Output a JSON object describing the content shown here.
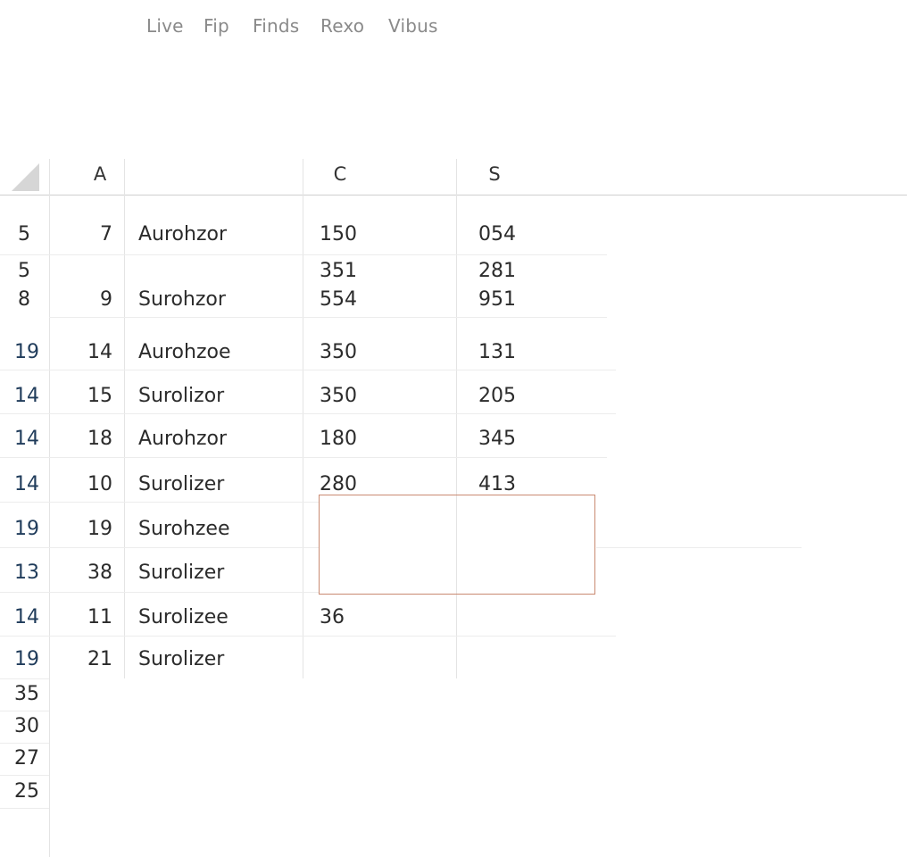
{
  "menu": {
    "items": [
      "Live",
      "Fip",
      "Finds",
      "Rexo",
      "Vibus"
    ]
  },
  "column_headers": [
    "A",
    "C",
    "S"
  ],
  "rows": [
    {
      "row": "5",
      "num": "7",
      "name": "Aurohzor",
      "c": "150",
      "s": "054"
    },
    {
      "row": "5",
      "num": "",
      "name": "",
      "c": "351",
      "s": "281"
    },
    {
      "row": "8",
      "num": "9",
      "name": "Surohzor",
      "c": "554",
      "s": "951"
    },
    {
      "row": "19",
      "num": "14",
      "name": "Aurohzoe",
      "c": "350",
      "s": "131"
    },
    {
      "row": "14",
      "num": "15",
      "name": "Surolizor",
      "c": "350",
      "s": "205"
    },
    {
      "row": "14",
      "num": "18",
      "name": "Aurohzor",
      "c": "180",
      "s": "345"
    },
    {
      "row": "14",
      "num": "10",
      "name": "Surolizer",
      "c": "280",
      "s": "413"
    },
    {
      "row": "19",
      "num": "19",
      "name": "Surohzee",
      "c": "",
      "s": ""
    },
    {
      "row": "13",
      "num": "38",
      "name": "Surolizer",
      "c": "",
      "s": ""
    },
    {
      "row": "14",
      "num": "11",
      "name": "Surolizee",
      "c": "36",
      "s": ""
    },
    {
      "row": "19",
      "num": "21",
      "name": "Surolizer",
      "c": "",
      "s": ""
    }
  ],
  "extra_row_numbers": [
    "35",
    "30",
    "27",
    "25"
  ],
  "colors": {
    "row_number_blue": "#1f3b5a",
    "selection_border": "#c98a72",
    "menu_text": "#8a8a8a"
  }
}
